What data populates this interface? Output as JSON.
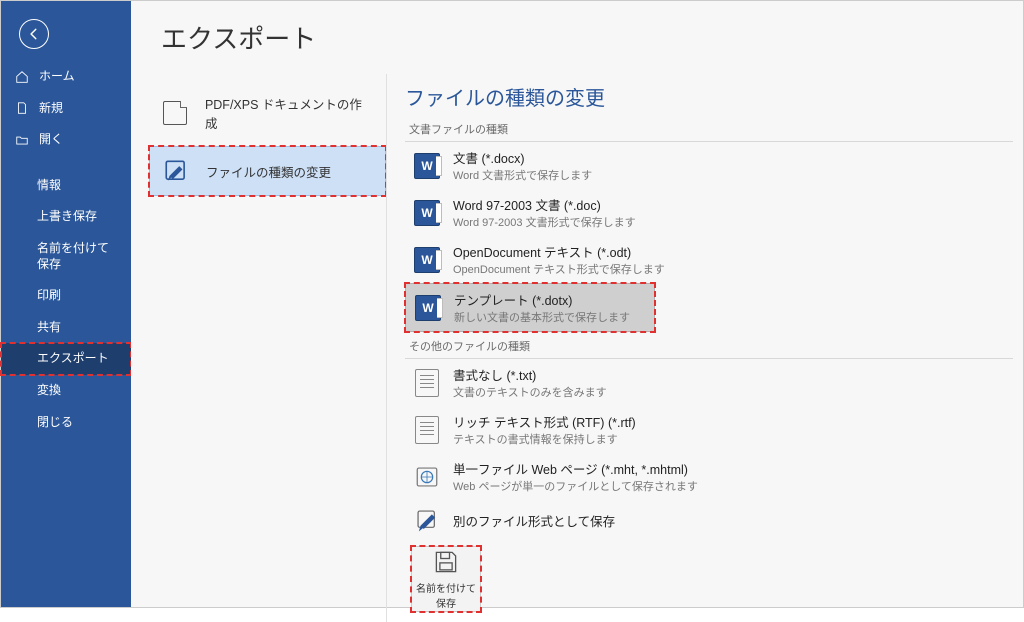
{
  "page": {
    "title": "エクスポート"
  },
  "sidebar": {
    "items": [
      {
        "label": "ホーム"
      },
      {
        "label": "新規"
      },
      {
        "label": "開く"
      },
      {
        "label": "情報"
      },
      {
        "label": "上書き保存"
      },
      {
        "label": "名前を付けて保存"
      },
      {
        "label": "印刷"
      },
      {
        "label": "共有"
      },
      {
        "label": "エクスポート"
      },
      {
        "label": "変換"
      },
      {
        "label": "閉じる"
      }
    ]
  },
  "export_options": {
    "pdf": "PDF/XPS ドキュメントの作成",
    "change_type": "ファイルの種類の変更"
  },
  "detail": {
    "title": "ファイルの種類の変更",
    "group_doc": "文書ファイルの種類",
    "group_other": "その他のファイルの種類",
    "types": {
      "docx": {
        "title": "文書 (*.docx)",
        "desc": "Word 文書形式で保存します"
      },
      "doc": {
        "title": "Word 97-2003 文書 (*.doc)",
        "desc": "Word 97-2003 文書形式で保存します"
      },
      "odt": {
        "title": "OpenDocument テキスト (*.odt)",
        "desc": "OpenDocument テキスト形式で保存します"
      },
      "dotx": {
        "title": "テンプレート (*.dotx)",
        "desc": "新しい文書の基本形式で保存します"
      },
      "txt": {
        "title": "書式なし (*.txt)",
        "desc": "文書のテキストのみを含みます"
      },
      "rtf": {
        "title": "リッチ テキスト形式 (RTF) (*.rtf)",
        "desc": "テキストの書式情報を保持します"
      },
      "mht": {
        "title": "単一ファイル Web ページ (*.mht, *.mhtml)",
        "desc": "Web ページが単一のファイルとして保存されます"
      },
      "other": {
        "title": "別のファイル形式として保存",
        "desc": ""
      }
    },
    "save_as_label": "名前を付けて保存"
  }
}
